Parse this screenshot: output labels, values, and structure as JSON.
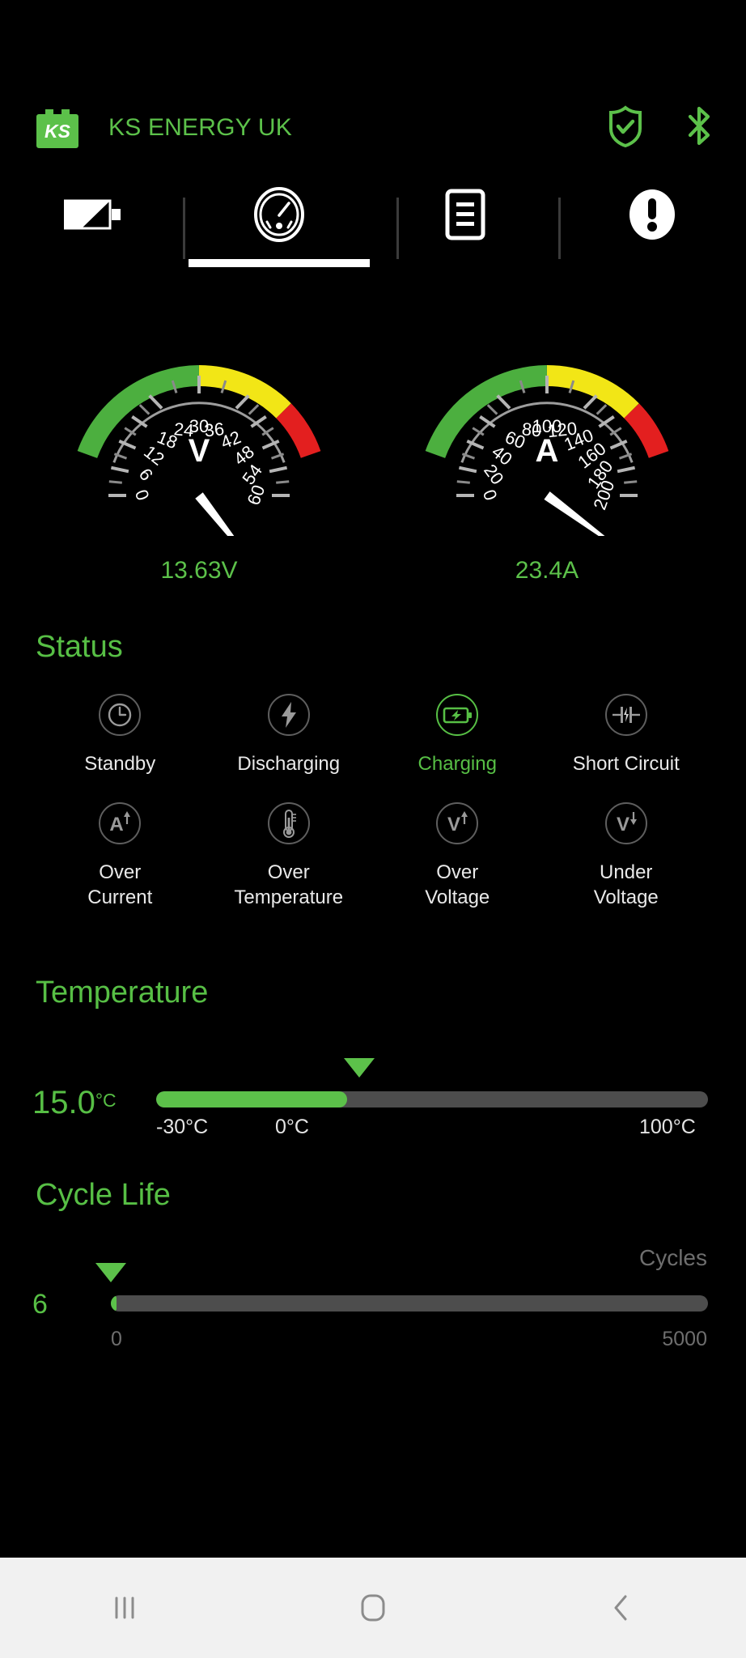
{
  "colors": {
    "brand_green": "#5cc14a",
    "heading_green": "#57bf45",
    "gauge_green": "#4caf3f",
    "gauge_yellow": "#f2e616",
    "gauge_red": "#e31f1f",
    "track_gray": "#4d4d4d",
    "background": "#000000",
    "navbar": "#f1f1f1"
  },
  "header": {
    "logo_icon": "ks-battery-logo-icon",
    "logo_text": "KS",
    "brand": "KS ENERGY UK",
    "shield_icon": "shield-check-icon",
    "bluetooth_icon": "bluetooth-icon"
  },
  "tabs": [
    {
      "id": "battery",
      "icon": "battery-half-icon",
      "active": false
    },
    {
      "id": "gauge",
      "icon": "gauge-dashboard-icon",
      "active": true
    },
    {
      "id": "records",
      "icon": "document-list-icon",
      "active": false
    },
    {
      "id": "alerts",
      "icon": "alert-exclamation-icon",
      "active": false
    }
  ],
  "gauges": [
    {
      "id": "voltage",
      "unit_label": "V",
      "reading": "13.63V",
      "value": 13.63,
      "min": 0,
      "max": 60,
      "tick_step": 6,
      "ticks": [
        "0",
        "6",
        "12",
        "18",
        "24",
        "30",
        "36",
        "42",
        "48",
        "54",
        "60"
      ],
      "bands": [
        {
          "color": "#4caf3f",
          "from": 0,
          "to": 30
        },
        {
          "color": "#f2e616",
          "from": 30,
          "to": 45
        },
        {
          "color": "#e31f1f",
          "from": 45,
          "to": 60
        }
      ]
    },
    {
      "id": "current",
      "unit_label": "A",
      "reading": "23.4A",
      "value": 23.4,
      "min": 0,
      "max": 200,
      "tick_step": 20,
      "ticks": [
        "0",
        "20",
        "40",
        "60",
        "80",
        "100",
        "120",
        "140",
        "160",
        "180",
        "200"
      ],
      "bands": [
        {
          "color": "#4caf3f",
          "from": 0,
          "to": 100
        },
        {
          "color": "#f2e616",
          "from": 100,
          "to": 150
        },
        {
          "color": "#e31f1f",
          "from": 150,
          "to": 200
        }
      ]
    }
  ],
  "status": {
    "title": "Status",
    "items": [
      {
        "id": "standby",
        "icon": "clock-icon",
        "label": "Standby",
        "active": false
      },
      {
        "id": "discharging",
        "icon": "lightning-bolt-icon",
        "label": "Discharging",
        "active": false
      },
      {
        "id": "charging",
        "icon": "battery-charging-icon",
        "label": "Charging",
        "active": true
      },
      {
        "id": "short-circuit",
        "icon": "short-circuit-icon",
        "label": "Short Circuit",
        "active": false
      },
      {
        "id": "over-current",
        "icon": "current-up-icon",
        "label": "Over\nCurrent",
        "active": false
      },
      {
        "id": "over-temperature",
        "icon": "thermometer-icon",
        "label": "Over\nTemperature",
        "active": false
      },
      {
        "id": "over-voltage",
        "icon": "voltage-up-icon",
        "label": "Over\nVoltage",
        "active": false
      },
      {
        "id": "under-voltage",
        "icon": "voltage-down-icon",
        "label": "Under\nVoltage",
        "active": false
      }
    ]
  },
  "temperature": {
    "title": "Temperature",
    "value": "15.0",
    "unit": "°C",
    "numeric": 15.0,
    "min": -30,
    "max": 100,
    "fill_percent": 34.6,
    "labels": {
      "min": "-30°C",
      "mid": "0°C",
      "max": "100°C"
    }
  },
  "cycle_life": {
    "title": "Cycle Life",
    "value": "6",
    "numeric": 6,
    "min": 0,
    "max": 5000,
    "fill_percent": 0.6,
    "unit_label": "Cycles",
    "labels": {
      "min": "0",
      "max": "5000"
    }
  },
  "navbar": {
    "recents": "recents-icon",
    "home": "home-icon",
    "back": "back-icon"
  }
}
